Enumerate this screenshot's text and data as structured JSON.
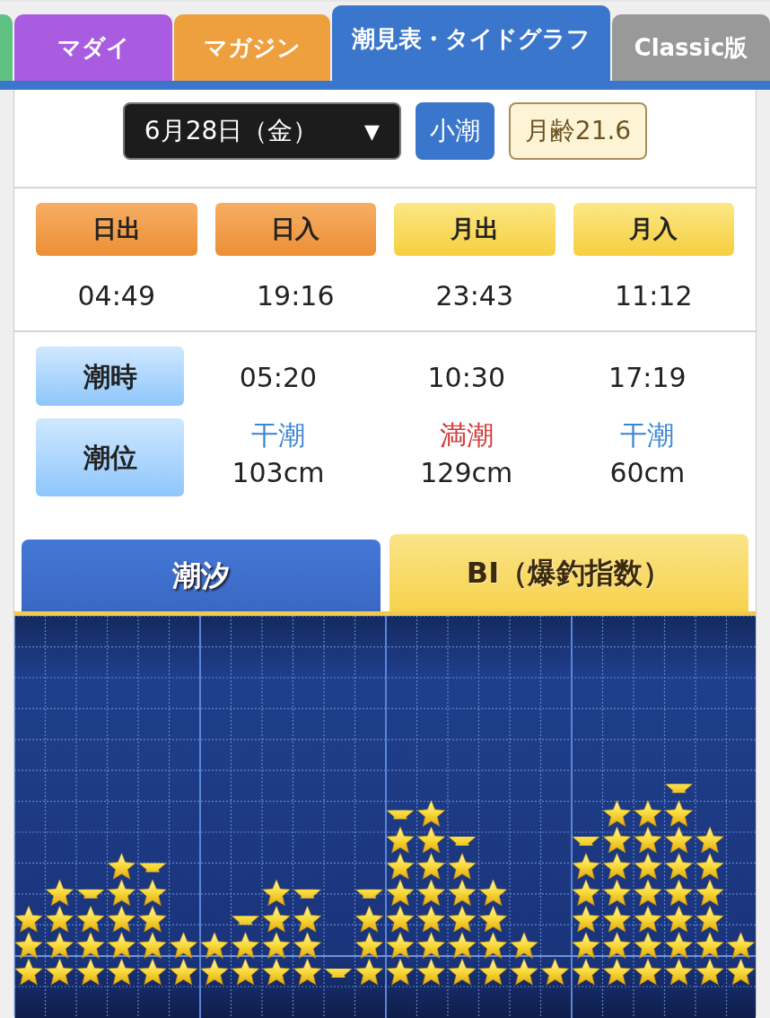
{
  "tabs": [
    {
      "color": "#5fc283",
      "selected": false
    },
    {
      "label": "マダイ",
      "color": "#a95ce0",
      "selected": false
    },
    {
      "label": "マガジン",
      "color": "#ee9f3e",
      "selected": false
    },
    {
      "label": "潮見表・タイドグラフ",
      "color": "#3a76cc",
      "selected": true
    },
    {
      "label": "Classic版",
      "color": "#999999",
      "selected": false
    }
  ],
  "date_select": {
    "value": "6月28日（金）",
    "caret": "▼"
  },
  "tide_name": "小潮",
  "moon_age": "月齢21.6",
  "sun_moon": [
    {
      "label": "日出",
      "kind": "sun",
      "time": "04:49"
    },
    {
      "label": "日入",
      "kind": "sun",
      "time": "19:16"
    },
    {
      "label": "月出",
      "kind": "moon",
      "time": "23:43"
    },
    {
      "label": "月入",
      "kind": "moon",
      "time": "11:12"
    }
  ],
  "tide": {
    "time_label": "潮時",
    "level_label": "潮位",
    "events": [
      {
        "time": "05:20",
        "type": "干潮",
        "kind": "low",
        "height": "103cm"
      },
      {
        "time": "10:30",
        "type": "満潮",
        "kind": "high",
        "height": "129cm"
      },
      {
        "time": "17:19",
        "type": "干潮",
        "kind": "low",
        "height": "60cm"
      }
    ]
  },
  "graph_tabs": [
    {
      "label": "潮汐",
      "kind": "tide",
      "selected": false
    },
    {
      "label": "BI（爆釣指数）",
      "kind": "bi",
      "selected": true
    }
  ]
}
